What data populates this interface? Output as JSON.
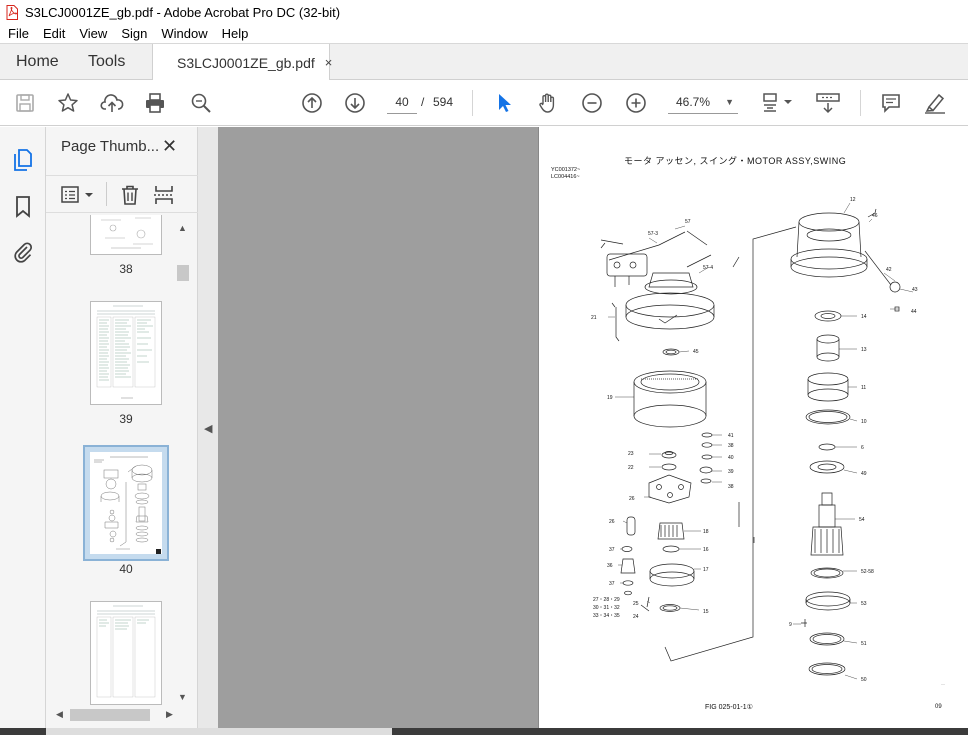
{
  "window": {
    "title": "S3LCJ0001ZE_gb.pdf - Adobe Acrobat Pro DC (32-bit)"
  },
  "menu": [
    "File",
    "Edit",
    "View",
    "Sign",
    "Window",
    "Help"
  ],
  "tabs": {
    "home": "Home",
    "tools": "Tools",
    "document": "S3LCJ0001ZE_gb.pdf",
    "close_glyph": "×"
  },
  "toolbar": {
    "current_page": "40",
    "page_separator": "/",
    "total_pages": "594",
    "zoom": "46.7%"
  },
  "thumbnails_panel": {
    "title": "Page Thumb...",
    "close_glyph": "✕",
    "pages": [
      {
        "label": "38",
        "selected": false
      },
      {
        "label": "39",
        "selected": false
      },
      {
        "label": "40",
        "selected": true
      },
      {
        "label": "",
        "selected": false
      }
    ]
  },
  "document_page": {
    "title": "モータ アッセン, スイング・MOTOR ASSY,SWING",
    "ref_lines": [
      "YC001372~",
      "LC004416~"
    ],
    "figure_label": "FIG 025-01-1①",
    "page_number": "09",
    "part_labels": [
      "57",
      "57-3",
      "57-4",
      "21",
      "45",
      "19",
      "23",
      "22",
      "26",
      "41",
      "38",
      "40",
      "39",
      "38",
      "26",
      "18",
      "16",
      "37",
      "36",
      "17",
      "37",
      "27・28・29",
      "30・31・32",
      "33・34・35",
      "25",
      "24",
      "15",
      "12",
      "46",
      "42",
      "43",
      "44",
      "14",
      "13",
      "11",
      "10",
      "6",
      "49",
      "54",
      "52-58",
      "53",
      "9",
      "51",
      "50"
    ]
  },
  "colors": {
    "accent": "#1473e6",
    "canvas_bg": "#9e9e9e",
    "panel_bg": "#f5f5f5",
    "pdf_red": "#d7261c"
  }
}
